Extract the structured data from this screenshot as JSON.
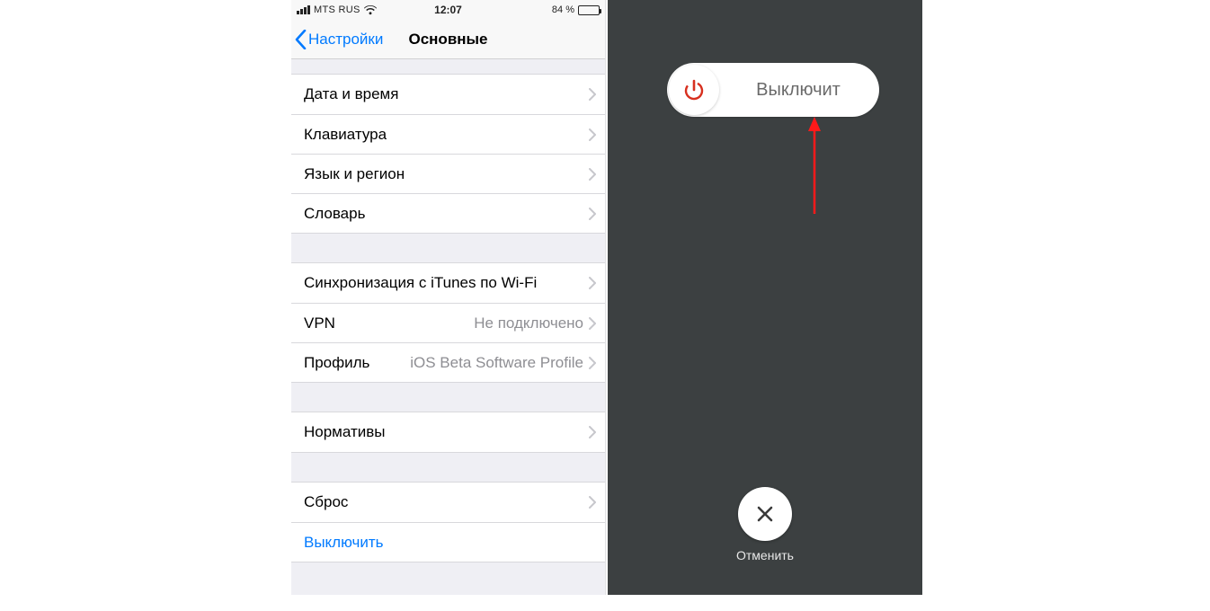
{
  "status_bar": {
    "carrier": "MTS RUS",
    "time": "12:07",
    "battery_text": "84 %"
  },
  "nav": {
    "back_label": "Настройки",
    "title": "Основные"
  },
  "groups": {
    "g1": [
      {
        "label": "Дата и время"
      },
      {
        "label": "Клавиатура"
      },
      {
        "label": "Язык и регион"
      },
      {
        "label": "Словарь"
      }
    ],
    "g2": [
      {
        "label": "Синхронизация с iTunes по Wi-Fi"
      },
      {
        "label": "VPN",
        "detail": "Не подключено"
      },
      {
        "label": "Профиль",
        "detail": "iOS Beta Software Profile"
      }
    ],
    "g3": [
      {
        "label": "Нормативы"
      }
    ],
    "g4": [
      {
        "label": "Сброс"
      },
      {
        "label": "Выключить",
        "is_link": true
      }
    ]
  },
  "power_off": {
    "slide_text": "Выключит",
    "cancel_label": "Отменить"
  },
  "colors": {
    "ios_blue": "#007aff",
    "ios_gray": "#8e8e93",
    "power_red": "#d7301f"
  }
}
